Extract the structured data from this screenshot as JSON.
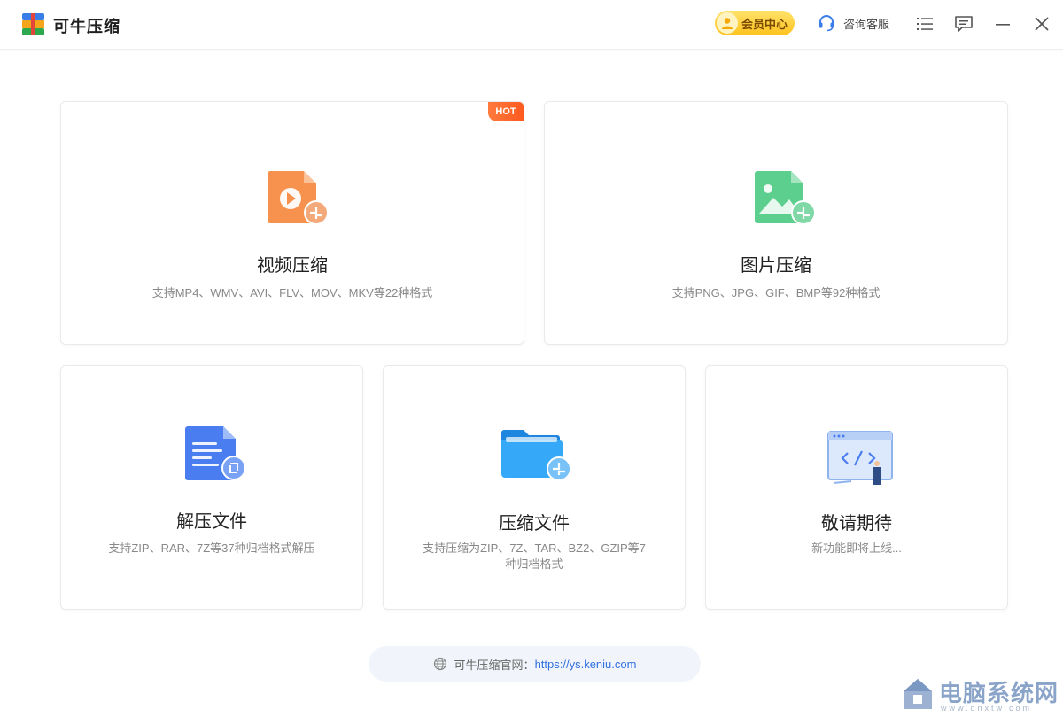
{
  "app": {
    "title": "可牛压缩"
  },
  "header": {
    "vip_label": "会员中心",
    "support_label": "咨询客服"
  },
  "cards": [
    {
      "title": "视频压缩",
      "desc": "支持MP4、WMV、AVI、FLV、MOV、MKV等22种格式",
      "badge": "HOT"
    },
    {
      "title": "图片压缩",
      "desc": "支持PNG、JPG、GIF、BMP等92种格式"
    },
    {
      "title": "解压文件",
      "desc": "支持ZIP、RAR、7Z等37种归档格式解压"
    },
    {
      "title": "压缩文件",
      "desc": "支持压缩为ZIP、7Z、TAR、BZ2、GZIP等7种归档格式"
    },
    {
      "title": "敬请期待",
      "desc": "新功能即将上线..."
    }
  ],
  "footer": {
    "label": "可牛压缩官网：",
    "url": "https://ys.keniu.com"
  },
  "watermark": {
    "text": "电脑系统网",
    "sub": "www.dnxtw.com"
  },
  "colors": {
    "accent": "#2f6fe0",
    "vip_gold": "#ffc21c",
    "hot": "#ff5a1f",
    "video_icon": "#f7924e",
    "image_icon": "#5ccf8e",
    "doc_icon": "#4a7ef0",
    "folder_icon": "#2c9cf5"
  },
  "icons": {
    "logo": "app-logo-icon",
    "vip": "user-avatar-icon",
    "support": "headset-icon",
    "menu": "list-menu-icon",
    "feedback": "message-icon",
    "minimize": "minimize-icon",
    "close": "close-icon",
    "globe": "globe-icon"
  }
}
